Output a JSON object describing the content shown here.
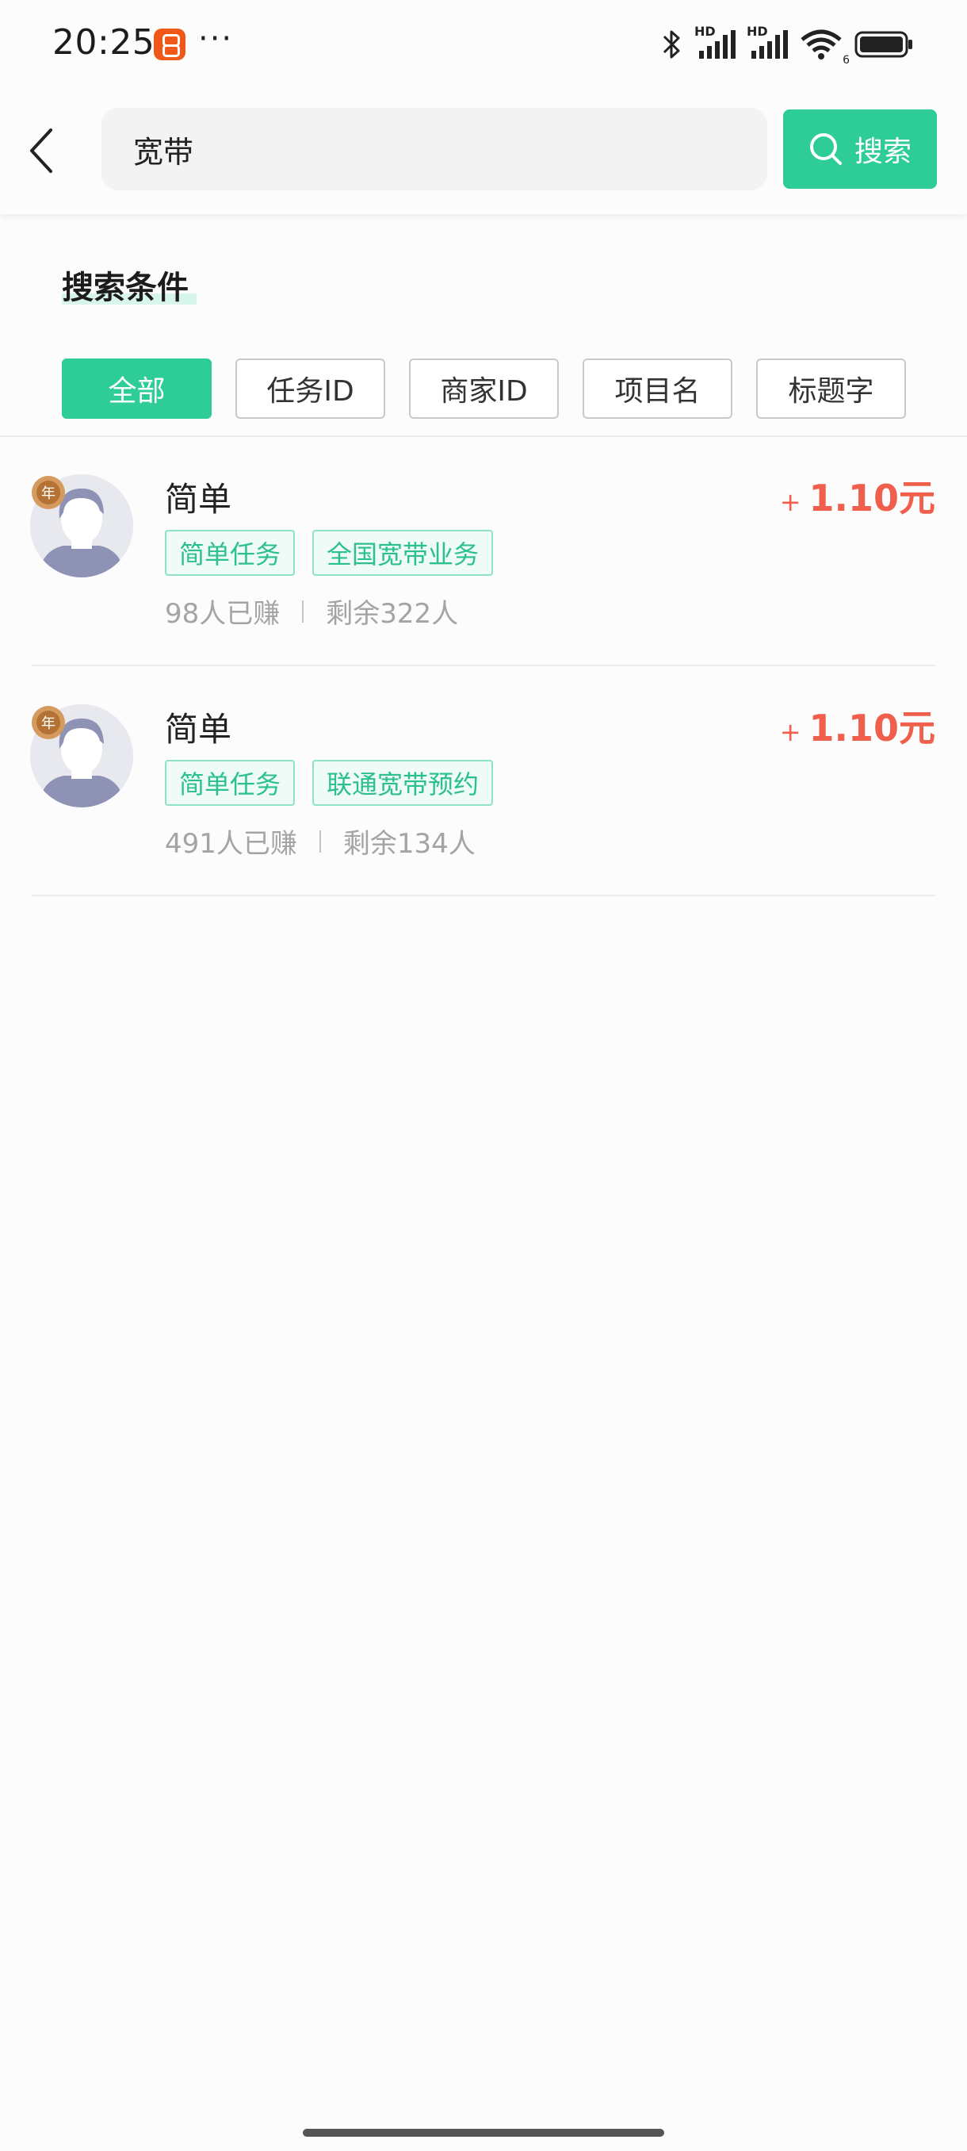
{
  "status_bar": {
    "time": "20:25",
    "more": "···",
    "network_1": "HD",
    "network_2": "HD",
    "wifi_sub": "6"
  },
  "search": {
    "query": "宽带",
    "button_label": "搜索"
  },
  "conditions": {
    "title": "搜索条件",
    "filters": [
      "全部",
      "任务ID",
      "商家ID",
      "项目名",
      "标题字"
    ],
    "selected": "全部"
  },
  "tasks": [
    {
      "title": "简单",
      "tags": [
        "简单任务",
        "全国宽带业务"
      ],
      "earned": "98人已赚",
      "remaining": "剩余322人",
      "reward_prefix": "+",
      "reward": "1.10元",
      "badge_text": "年"
    },
    {
      "title": "简单",
      "tags": [
        "简单任务",
        "联通宽带预约"
      ],
      "earned": "491人已赚",
      "remaining": "剩余134人",
      "reward_prefix": "+",
      "reward": "1.10元",
      "badge_text": "年"
    }
  ],
  "colors": {
    "accent": "#2ecc96",
    "reward": "#ef5f4b",
    "tag_border": "#8de3c4"
  }
}
